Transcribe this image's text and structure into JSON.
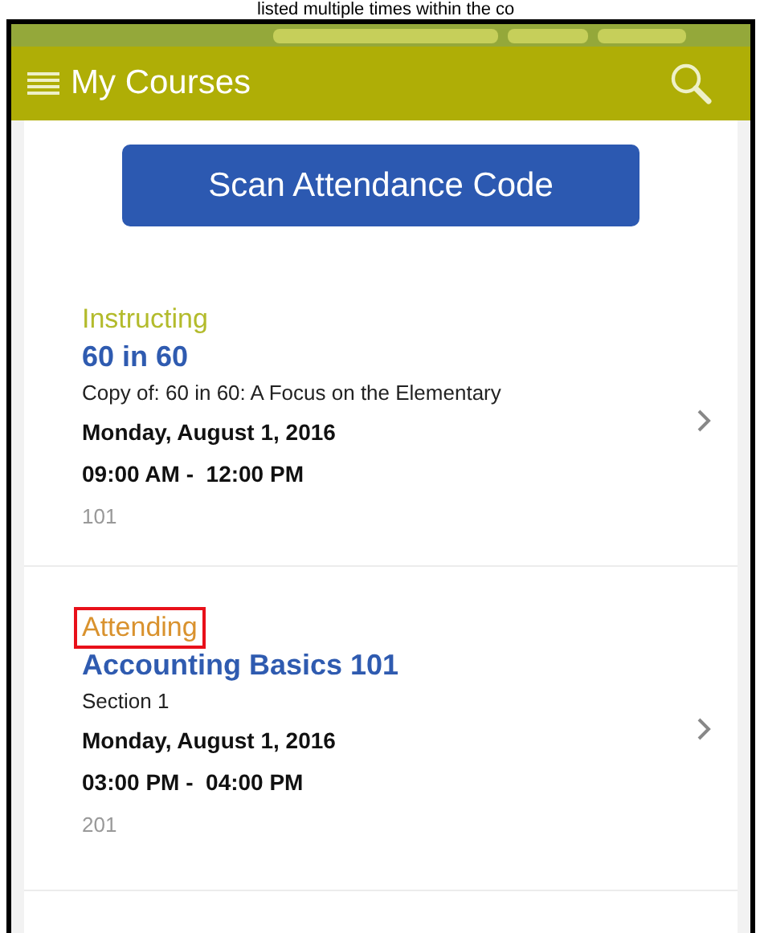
{
  "document_text": "listed multiple times within the co",
  "app_bar": {
    "title": "My Courses"
  },
  "scan_button": {
    "label": "Scan Attendance Code"
  },
  "courses": [
    {
      "status": "Instructing",
      "color": "#b3bb2c",
      "highlighted": false,
      "title": "60 in 60",
      "subtitle": "Copy of: 60 in 60: A Focus on the Elementary",
      "date": "Monday, August 1, 2016",
      "time": "09:00 AM -  12:00 PM",
      "room": "101"
    },
    {
      "status": "Attending",
      "color": "#d9922e",
      "highlighted": true,
      "title": "Accounting Basics 101",
      "subtitle": "Section 1",
      "date": "Monday, August 1, 2016",
      "time": "03:00 PM -  04:00 PM",
      "room": "201"
    }
  ]
}
